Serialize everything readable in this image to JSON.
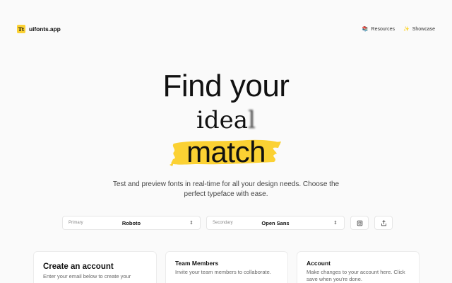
{
  "brand": {
    "logo_mark": "Tt",
    "name": "uifonts.app"
  },
  "nav": {
    "links": [
      {
        "label": "Resources",
        "icon": "book-icon"
      },
      {
        "label": "Showcase",
        "icon": "sparkle-icon"
      }
    ]
  },
  "hero": {
    "line1": "Find your",
    "line2_clear": "idea",
    "line2_blur": "l",
    "line3": "match",
    "description": "Test and preview fonts in real-time for all your design needs. Choose the perfect typeface with ease.",
    "accent_color": "#fbd133"
  },
  "controls": {
    "primary": {
      "label": "Primary",
      "value": "Roboto"
    },
    "secondary": {
      "label": "Secondary",
      "value": "Open Sans"
    }
  },
  "cards": [
    {
      "title": "Create an account",
      "text": "Enter your email below to create your"
    },
    {
      "title": "Team Members",
      "text": "Invite your team members to collaborate."
    },
    {
      "title": "Account",
      "text": "Make changes to your account here. Click save when you're done."
    }
  ]
}
